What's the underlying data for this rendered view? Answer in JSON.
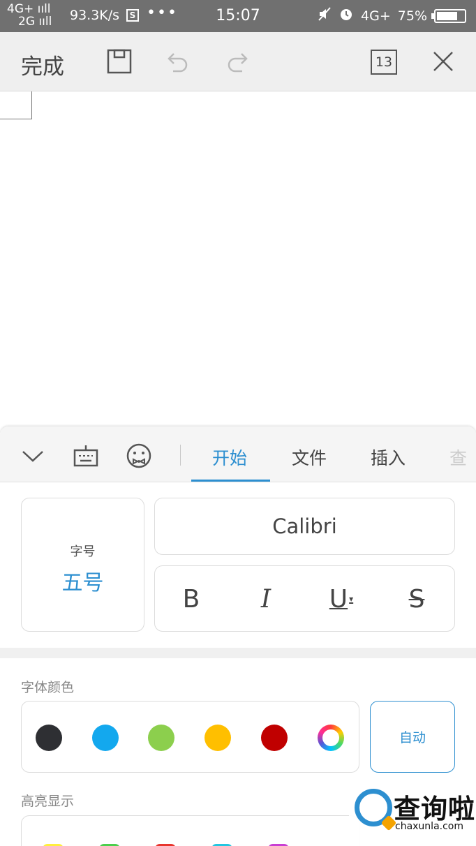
{
  "status_bar": {
    "network_line1": "4G+ ııll",
    "network_line2": "2G ııll",
    "speed": "93.3K/s",
    "app_badge": "S",
    "more": "•••",
    "time": "15:07",
    "network_right": "4G+",
    "battery": "75%",
    "battery_level": 0.75
  },
  "toolbar": {
    "done_label": "完成",
    "page_count": "13"
  },
  "panel": {
    "tabs": [
      "开始",
      "文件",
      "插入",
      "查"
    ],
    "active_tab": "开始",
    "font_size_label": "字号",
    "font_size_value": "五号",
    "font_name": "Calibri",
    "style_buttons": {
      "bold": "B",
      "italic": "I",
      "underline": "U",
      "strike": "S"
    },
    "font_color_label": "字体颜色",
    "font_colors": [
      "#2e2f33",
      "#13a8ee",
      "#8ccf4d",
      "#ffbf00",
      "#c00000"
    ],
    "auto_label": "自动",
    "highlight_label": "高亮显示",
    "highlight_colors": [
      "#ffef3d",
      "#4ccf4d",
      "#e8352d",
      "#24c6e0",
      "#c93fd3"
    ]
  },
  "watermark": {
    "text": "查询啦",
    "domain": "chaxunla.com"
  },
  "colors": {
    "accent": "#2d8fd0",
    "status_bar": "#707070",
    "toolbar": "#efefef"
  }
}
